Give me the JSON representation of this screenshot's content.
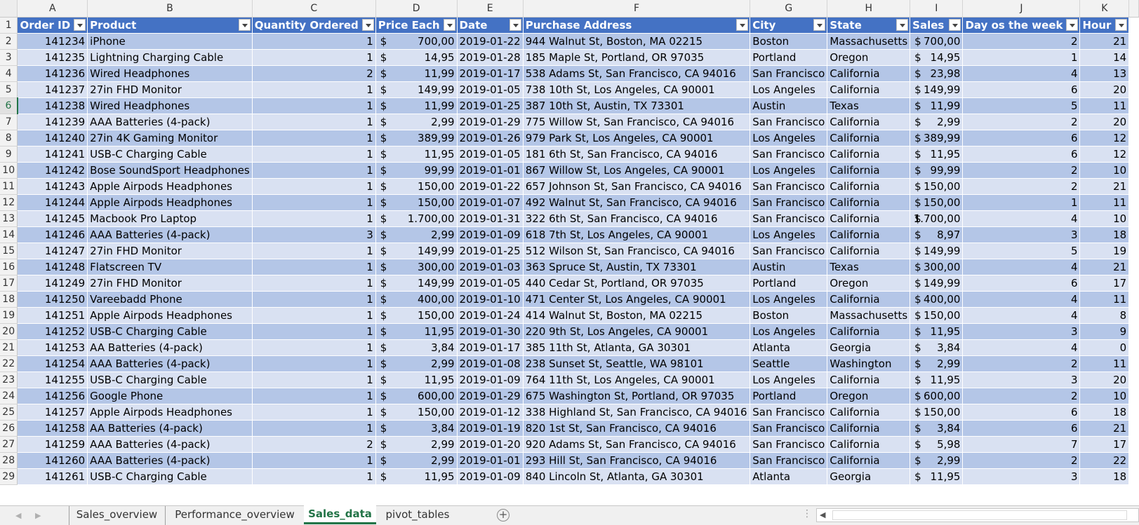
{
  "column_letters": [
    "A",
    "B",
    "C",
    "D",
    "E",
    "F",
    "G",
    "H",
    "I",
    "J",
    "K"
  ],
  "headers": [
    "Order ID",
    "Product",
    "Quantity Ordered",
    "Price Each",
    "Date",
    "Purchase Address",
    "City",
    "State",
    "Sales",
    "Day os the week",
    "Hour"
  ],
  "currency_symbol": "$",
  "selected_row": 6,
  "rows": [
    {
      "n": 2,
      "id": "141234",
      "product": "iPhone",
      "qty": "1",
      "price": "700,00",
      "date": "2019-01-22",
      "address": "944 Walnut St, Boston, MA 02215",
      "city": "Boston",
      "state": "Massachusetts",
      "sales": "700,00",
      "dow": "2",
      "hour": "21"
    },
    {
      "n": 3,
      "id": "141235",
      "product": "Lightning Charging Cable",
      "qty": "1",
      "price": "14,95",
      "date": "2019-01-28",
      "address": "185 Maple St, Portland, OR 97035",
      "city": "Portland",
      "state": "Oregon",
      "sales": "14,95",
      "dow": "1",
      "hour": "14"
    },
    {
      "n": 4,
      "id": "141236",
      "product": "Wired Headphones",
      "qty": "2",
      "price": "11,99",
      "date": "2019-01-17",
      "address": "538 Adams St, San Francisco, CA 94016",
      "city": "San Francisco",
      "state": "California",
      "sales": "23,98",
      "dow": "4",
      "hour": "13"
    },
    {
      "n": 5,
      "id": "141237",
      "product": "27in FHD Monitor",
      "qty": "1",
      "price": "149,99",
      "date": "2019-01-05",
      "address": "738 10th St, Los Angeles, CA 90001",
      "city": "Los Angeles",
      "state": "California",
      "sales": "149,99",
      "dow": "6",
      "hour": "20"
    },
    {
      "n": 6,
      "id": "141238",
      "product": "Wired Headphones",
      "qty": "1",
      "price": "11,99",
      "date": "2019-01-25",
      "address": "387 10th St, Austin, TX 73301",
      "city": "Austin",
      "state": "Texas",
      "sales": "11,99",
      "dow": "5",
      "hour": "11"
    },
    {
      "n": 7,
      "id": "141239",
      "product": "AAA Batteries (4-pack)",
      "qty": "1",
      "price": "2,99",
      "date": "2019-01-29",
      "address": "775 Willow St, San Francisco, CA 94016",
      "city": "San Francisco",
      "state": "California",
      "sales": "2,99",
      "dow": "2",
      "hour": "20"
    },
    {
      "n": 8,
      "id": "141240",
      "product": "27in 4K Gaming Monitor",
      "qty": "1",
      "price": "389,99",
      "date": "2019-01-26",
      "address": "979 Park St, Los Angeles, CA 90001",
      "city": "Los Angeles",
      "state": "California",
      "sales": "389,99",
      "dow": "6",
      "hour": "12"
    },
    {
      "n": 9,
      "id": "141241",
      "product": "USB-C Charging Cable",
      "qty": "1",
      "price": "11,95",
      "date": "2019-01-05",
      "address": "181 6th St, San Francisco, CA 94016",
      "city": "San Francisco",
      "state": "California",
      "sales": "11,95",
      "dow": "6",
      "hour": "12"
    },
    {
      "n": 10,
      "id": "141242",
      "product": "Bose SoundSport Headphones",
      "qty": "1",
      "price": "99,99",
      "date": "2019-01-01",
      "address": "867 Willow St, Los Angeles, CA 90001",
      "city": "Los Angeles",
      "state": "California",
      "sales": "99,99",
      "dow": "2",
      "hour": "10"
    },
    {
      "n": 11,
      "id": "141243",
      "product": "Apple Airpods Headphones",
      "qty": "1",
      "price": "150,00",
      "date": "2019-01-22",
      "address": "657 Johnson St, San Francisco, CA 94016",
      "city": "San Francisco",
      "state": "California",
      "sales": "150,00",
      "dow": "2",
      "hour": "21"
    },
    {
      "n": 12,
      "id": "141244",
      "product": "Apple Airpods Headphones",
      "qty": "1",
      "price": "150,00",
      "date": "2019-01-07",
      "address": "492 Walnut St, San Francisco, CA 94016",
      "city": "San Francisco",
      "state": "California",
      "sales": "150,00",
      "dow": "1",
      "hour": "11"
    },
    {
      "n": 13,
      "id": "141245",
      "product": "Macbook Pro Laptop",
      "qty": "1",
      "price": "1.700,00",
      "date": "2019-01-31",
      "address": "322 6th St, San Francisco, CA 94016",
      "city": "San Francisco",
      "state": "California",
      "sales": "1.700,00",
      "dow": "4",
      "hour": "10"
    },
    {
      "n": 14,
      "id": "141246",
      "product": "AAA Batteries (4-pack)",
      "qty": "3",
      "price": "2,99",
      "date": "2019-01-09",
      "address": "618 7th St, Los Angeles, CA 90001",
      "city": "Los Angeles",
      "state": "California",
      "sales": "8,97",
      "dow": "3",
      "hour": "18"
    },
    {
      "n": 15,
      "id": "141247",
      "product": "27in FHD Monitor",
      "qty": "1",
      "price": "149,99",
      "date": "2019-01-25",
      "address": "512 Wilson St, San Francisco, CA 94016",
      "city": "San Francisco",
      "state": "California",
      "sales": "149,99",
      "dow": "5",
      "hour": "19"
    },
    {
      "n": 16,
      "id": "141248",
      "product": "Flatscreen TV",
      "qty": "1",
      "price": "300,00",
      "date": "2019-01-03",
      "address": "363 Spruce St, Austin, TX 73301",
      "city": "Austin",
      "state": "Texas",
      "sales": "300,00",
      "dow": "4",
      "hour": "21"
    },
    {
      "n": 17,
      "id": "141249",
      "product": "27in FHD Monitor",
      "qty": "1",
      "price": "149,99",
      "date": "2019-01-05",
      "address": "440 Cedar St, Portland, OR 97035",
      "city": "Portland",
      "state": "Oregon",
      "sales": "149,99",
      "dow": "6",
      "hour": "17"
    },
    {
      "n": 18,
      "id": "141250",
      "product": "Vareebadd Phone",
      "qty": "1",
      "price": "400,00",
      "date": "2019-01-10",
      "address": "471 Center St, Los Angeles, CA 90001",
      "city": "Los Angeles",
      "state": "California",
      "sales": "400,00",
      "dow": "4",
      "hour": "11"
    },
    {
      "n": 19,
      "id": "141251",
      "product": "Apple Airpods Headphones",
      "qty": "1",
      "price": "150,00",
      "date": "2019-01-24",
      "address": "414 Walnut St, Boston, MA 02215",
      "city": "Boston",
      "state": "Massachusetts",
      "sales": "150,00",
      "dow": "4",
      "hour": "8"
    },
    {
      "n": 20,
      "id": "141252",
      "product": "USB-C Charging Cable",
      "qty": "1",
      "price": "11,95",
      "date": "2019-01-30",
      "address": "220 9th St, Los Angeles, CA 90001",
      "city": "Los Angeles",
      "state": "California",
      "sales": "11,95",
      "dow": "3",
      "hour": "9"
    },
    {
      "n": 21,
      "id": "141253",
      "product": "AA Batteries (4-pack)",
      "qty": "1",
      "price": "3,84",
      "date": "2019-01-17",
      "address": "385 11th St, Atlanta, GA 30301",
      "city": "Atlanta",
      "state": "Georgia",
      "sales": "3,84",
      "dow": "4",
      "hour": "0"
    },
    {
      "n": 22,
      "id": "141254",
      "product": "AAA Batteries (4-pack)",
      "qty": "1",
      "price": "2,99",
      "date": "2019-01-08",
      "address": "238 Sunset St, Seattle, WA 98101",
      "city": "Seattle",
      "state": "Washington",
      "sales": "2,99",
      "dow": "2",
      "hour": "11"
    },
    {
      "n": 23,
      "id": "141255",
      "product": "USB-C Charging Cable",
      "qty": "1",
      "price": "11,95",
      "date": "2019-01-09",
      "address": "764 11th St, Los Angeles, CA 90001",
      "city": "Los Angeles",
      "state": "California",
      "sales": "11,95",
      "dow": "3",
      "hour": "20"
    },
    {
      "n": 24,
      "id": "141256",
      "product": "Google Phone",
      "qty": "1",
      "price": "600,00",
      "date": "2019-01-29",
      "address": "675 Washington St, Portland, OR 97035",
      "city": "Portland",
      "state": "Oregon",
      "sales": "600,00",
      "dow": "2",
      "hour": "10"
    },
    {
      "n": 25,
      "id": "141257",
      "product": "Apple Airpods Headphones",
      "qty": "1",
      "price": "150,00",
      "date": "2019-01-12",
      "address": "338 Highland St, San Francisco, CA 94016",
      "city": "San Francisco",
      "state": "California",
      "sales": "150,00",
      "dow": "6",
      "hour": "18"
    },
    {
      "n": 26,
      "id": "141258",
      "product": "AA Batteries (4-pack)",
      "qty": "1",
      "price": "3,84",
      "date": "2019-01-19",
      "address": "820 1st St, San Francisco, CA 94016",
      "city": "San Francisco",
      "state": "California",
      "sales": "3,84",
      "dow": "6",
      "hour": "21"
    },
    {
      "n": 27,
      "id": "141259",
      "product": "AAA Batteries (4-pack)",
      "qty": "2",
      "price": "2,99",
      "date": "2019-01-20",
      "address": "920 Adams St, San Francisco, CA 94016",
      "city": "San Francisco",
      "state": "California",
      "sales": "5,98",
      "dow": "7",
      "hour": "17"
    },
    {
      "n": 28,
      "id": "141260",
      "product": "AAA Batteries (4-pack)",
      "qty": "1",
      "price": "2,99",
      "date": "2019-01-01",
      "address": "293 Hill St, San Francisco, CA 94016",
      "city": "San Francisco",
      "state": "California",
      "sales": "2,99",
      "dow": "2",
      "hour": "22"
    },
    {
      "n": 29,
      "id": "141261",
      "product": "USB-C Charging Cable",
      "qty": "1",
      "price": "11,95",
      "date": "2019-01-09",
      "address": "840 Lincoln St, Atlanta, GA 30301",
      "city": "Atlanta",
      "state": "Georgia",
      "sales": "11,95",
      "dow": "3",
      "hour": "18"
    }
  ],
  "sheet_tabs": [
    {
      "label": "Sales_overview",
      "active": false
    },
    {
      "label": "Performance_overview",
      "active": false
    },
    {
      "label": "Sales_data",
      "active": true
    },
    {
      "label": "pivot_tables",
      "active": false
    }
  ],
  "icons": {
    "prev_sheet": "chevron-left-icon",
    "next_sheet": "chevron-right-icon",
    "add_sheet": "plus-circle-icon",
    "filter": "dropdown-filter-icon"
  },
  "colors": {
    "header_blue": "#4472c4",
    "band_dark": "#b4c6e7",
    "band_light": "#d9e1f2",
    "excel_green": "#217346"
  }
}
